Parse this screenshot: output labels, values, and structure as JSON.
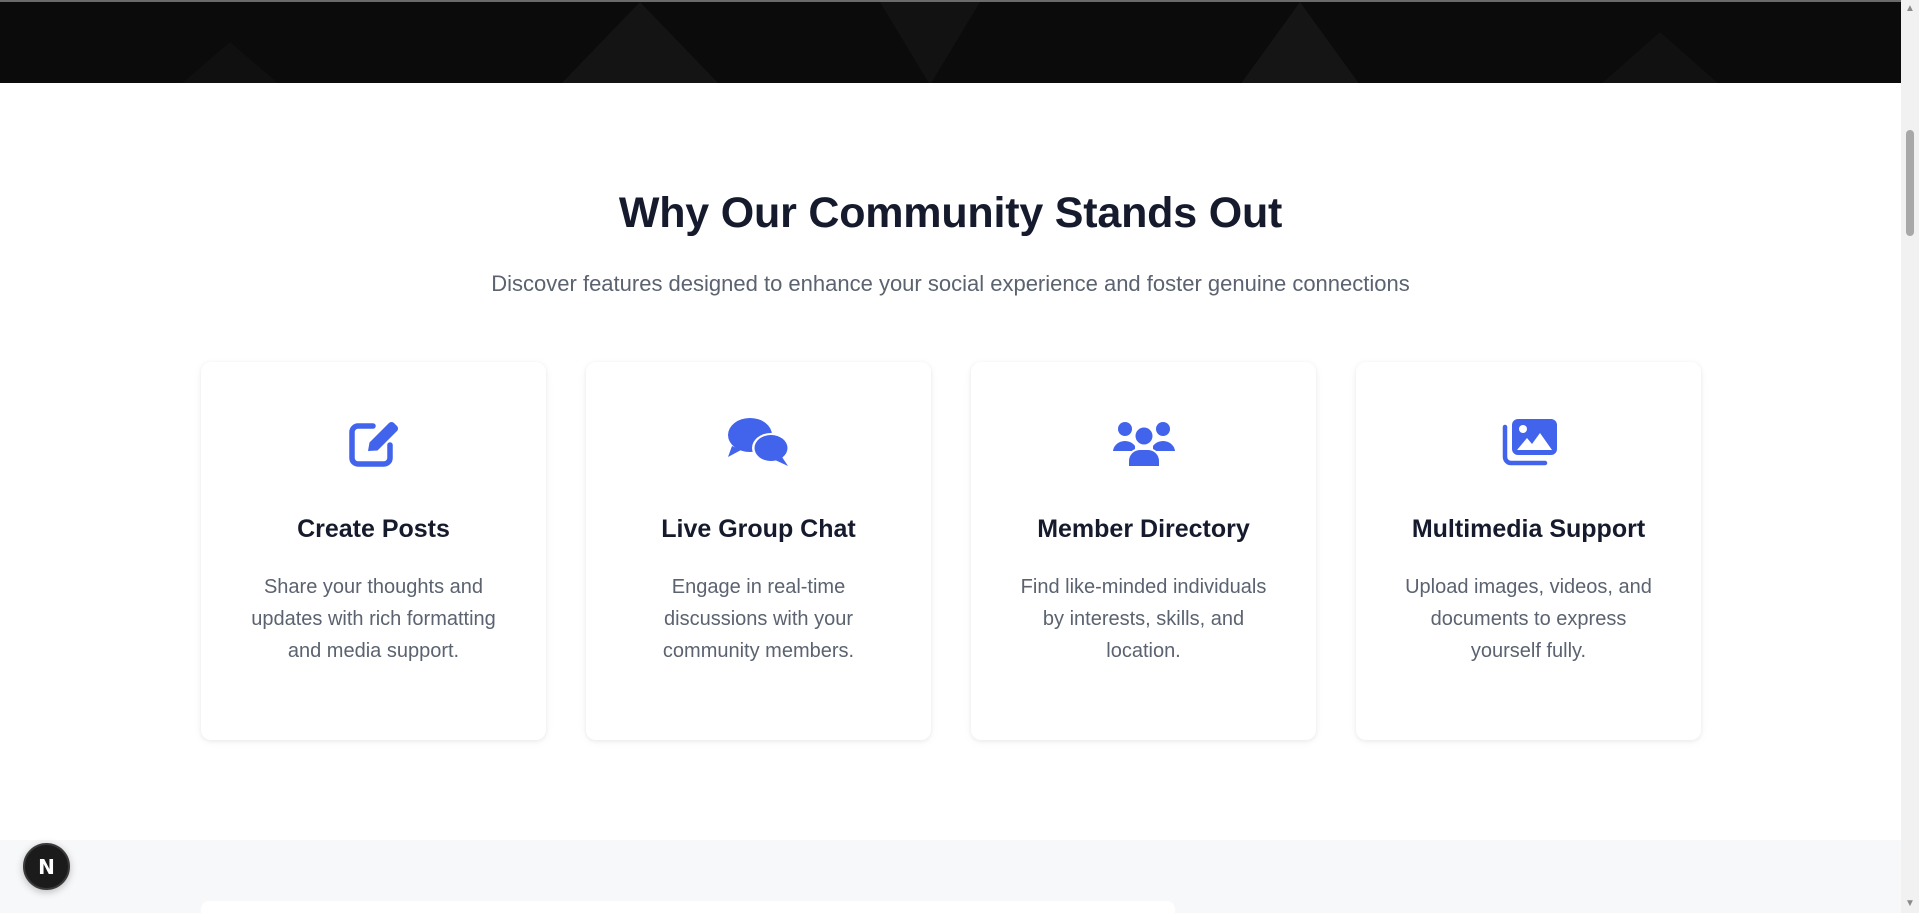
{
  "features_section": {
    "title": "Why Our Community Stands Out",
    "subtitle": "Discover features designed to enhance your social experience and foster genuine connections",
    "accent_color": "#4263eb",
    "cards": [
      {
        "icon": "edit-icon",
        "title": "Create Posts",
        "description": "Share your thoughts and updates with rich formatting and media support."
      },
      {
        "icon": "chat-bubbles-icon",
        "title": "Live Group Chat",
        "description": "Engage in real-time discussions with your community members."
      },
      {
        "icon": "users-icon",
        "title": "Member Directory",
        "description": "Find like-minded individuals by interests, skills, and location."
      },
      {
        "icon": "images-icon",
        "title": "Multimedia Support",
        "description": "Upload images, videos, and documents to express yourself fully."
      }
    ]
  },
  "dev_indicator": {
    "label": "N"
  },
  "colors": {
    "hero_background": "#0b0b0b",
    "heading": "#151a2d",
    "body_text": "#5b6270",
    "next_section_background": "#f7f8fa"
  }
}
